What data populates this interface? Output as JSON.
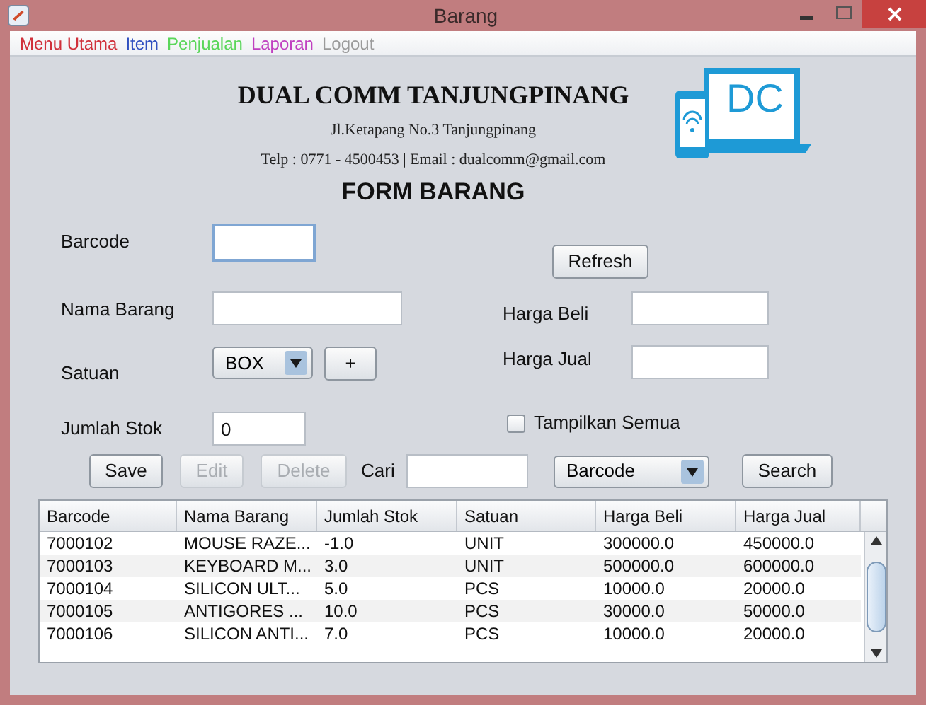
{
  "window": {
    "title": "Barang"
  },
  "menu": [
    {
      "label": "Menu Utama",
      "color": "#d0303a"
    },
    {
      "label": "Item",
      "color": "#3050c0"
    },
    {
      "label": "Penjualan",
      "color": "#5ad65a"
    },
    {
      "label": "Laporan",
      "color": "#c040c0"
    },
    {
      "label": "Logout",
      "color": "#9a9a9a"
    }
  ],
  "header": {
    "company": "DUAL COMM TANJUNGPINANG",
    "address": "Jl.Ketapang No.3 Tanjungpinang",
    "contact": "Telp : 0771 - 4500453 | Email : dualcomm@gmail.com",
    "form_title": "FORM BARANG",
    "logo_text": "DC"
  },
  "form": {
    "barcode": {
      "label": "Barcode",
      "focused": true
    },
    "refresh_button": "Refresh",
    "nama_barang": {
      "label": "Nama Barang"
    },
    "harga_beli": {
      "label": "Harga Beli"
    },
    "satuan": {
      "label": "Satuan",
      "value": "BOX"
    },
    "add_button": "+",
    "harga_jual": {
      "label": "Harga Jual"
    },
    "jumlah_stok": {
      "label": "Jumlah Stok",
      "value": "0"
    },
    "tampilkan_semua": {
      "label": "Tampilkan Semua",
      "checked": false
    }
  },
  "actions": [
    {
      "label": "Save",
      "disabled": false
    },
    {
      "label": "Edit",
      "disabled": true
    },
    {
      "label": "Delete",
      "disabled": true
    }
  ],
  "search": {
    "label": "Cari",
    "field": "Barcode",
    "button": "Search"
  },
  "table": {
    "columns": [
      "Barcode",
      "Nama Barang",
      "Jumlah Stok",
      "Satuan",
      "Harga Beli",
      "Harga Jual"
    ],
    "rows": [
      [
        "7000102",
        "MOUSE RAZE...",
        "-1.0",
        "UNIT",
        "300000.0",
        "450000.0"
      ],
      [
        "7000103",
        "KEYBOARD M...",
        "3.0",
        "UNIT",
        "500000.0",
        "600000.0"
      ],
      [
        "7000104",
        "SILICON ULT...",
        "5.0",
        "PCS",
        "10000.0",
        "20000.0"
      ],
      [
        "7000105",
        "ANTIGORES ...",
        "10.0",
        "PCS",
        "30000.0",
        "50000.0"
      ],
      [
        "7000106",
        "SILICON ANTI...",
        "7.0",
        "PCS",
        "10000.0",
        "20000.0"
      ]
    ]
  }
}
